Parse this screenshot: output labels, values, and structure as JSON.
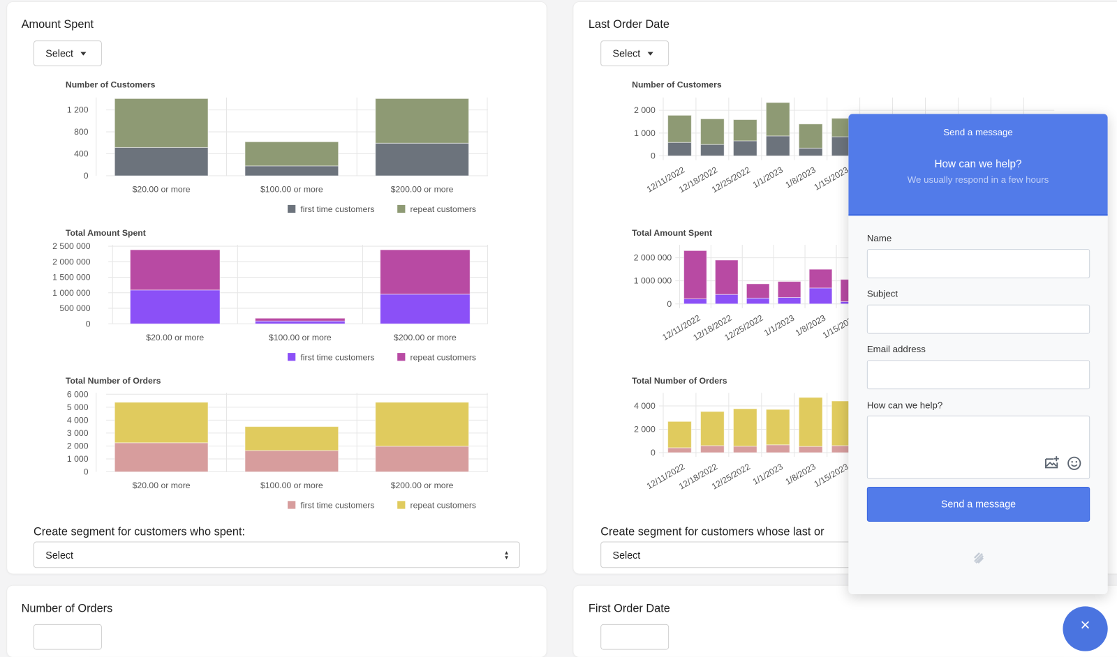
{
  "colors": {
    "accent": "#527be9",
    "first_gray": "#6c737c",
    "repeat_olive": "#8e9a74",
    "first_purple": "#8b50f7",
    "repeat_magenta": "#b84aa3",
    "first_pink": "#d79d9d",
    "repeat_yellow": "#e0cb5e"
  },
  "cards": {
    "amount_spent": {
      "title": "Amount Spent",
      "select_label": "Select",
      "segment_label": "Create segment for customers who spent:",
      "segment_value": "Select"
    },
    "last_order_date": {
      "title": "Last Order Date",
      "select_label": "Select",
      "segment_label": "Create segment for customers whose last or",
      "segment_value": "Select"
    },
    "number_of_orders": {
      "title": "Number of Orders"
    },
    "first_order_date": {
      "title": "First Order Date"
    }
  },
  "chart_data": [
    {
      "id": "amount_customers",
      "type": "bar",
      "stacked": true,
      "title": "Number of Customers",
      "categories": [
        "$20.00 or more",
        "$100.00 or more",
        "$200.00 or more"
      ],
      "ylim": [
        0,
        1400
      ],
      "yticks": [
        0,
        400,
        800,
        1200
      ],
      "ytick_labels": [
        "0",
        "400",
        "800",
        "1 200"
      ],
      "legend": "bottom-right",
      "series": [
        {
          "name": "first time customers",
          "color": "#6c737c",
          "values": [
            516,
            180,
            594
          ]
        },
        {
          "name": "repeat customers",
          "color": "#8e9a74",
          "values": [
            890,
            439,
            812
          ]
        }
      ]
    },
    {
      "id": "amount_total",
      "type": "bar",
      "stacked": true,
      "title": "Total Amount Spent",
      "categories": [
        "$20.00 or more",
        "$100.00 or more",
        "$200.00 or more"
      ],
      "ylim": [
        0,
        2500000
      ],
      "yticks": [
        0,
        500000,
        1000000,
        1500000,
        2000000,
        2500000
      ],
      "ytick_labels": [
        "0",
        "500 000",
        "1 000 000",
        "1 500 000",
        "2 000 000",
        "2 500 000"
      ],
      "legend": "bottom-right",
      "series": [
        {
          "name": "first time customers",
          "color": "#8b50f7",
          "values": [
            1090000,
            90000,
            955000
          ]
        },
        {
          "name": "repeat customers",
          "color": "#b84aa3",
          "values": [
            1296000,
            90000,
            1431000
          ]
        }
      ]
    },
    {
      "id": "amount_orders",
      "type": "bar",
      "stacked": true,
      "title": "Total Number of Orders",
      "categories": [
        "$20.00 or more",
        "$100.00 or more",
        "$200.00 or more"
      ],
      "ylim": [
        0,
        6000
      ],
      "yticks": [
        0,
        1000,
        2000,
        3000,
        4000,
        5000,
        6000
      ],
      "ytick_labels": [
        "0",
        "1 000",
        "2 000",
        "3 000",
        "4 000",
        "5 000",
        "6 000"
      ],
      "legend": "bottom-right",
      "series": [
        {
          "name": "first time customers",
          "color": "#d79d9d",
          "values": [
            2250,
            1650,
            1980
          ]
        },
        {
          "name": "repeat customers",
          "color": "#e0cb5e",
          "values": [
            3130,
            1850,
            3400
          ]
        }
      ]
    },
    {
      "id": "date_customers",
      "type": "bar",
      "stacked": true,
      "title": "Number of Customers",
      "categories": [
        "12/11/2022",
        "12/18/2022",
        "12/25/2022",
        "1/1/2023",
        "1/8/2023",
        "1/15/2023"
      ],
      "ylim": [
        0,
        2500
      ],
      "yticks": [
        0,
        1000,
        2000
      ],
      "ytick_labels": [
        "0",
        "1 000",
        "2 000"
      ],
      "series": [
        {
          "name": "first time customers",
          "color": "#6c737c",
          "values": [
            590,
            500,
            660,
            875,
            340,
            840
          ]
        },
        {
          "name": "repeat customers",
          "color": "#8e9a74",
          "values": [
            1190,
            1125,
            930,
            1465,
            1060,
            810
          ]
        }
      ]
    },
    {
      "id": "date_total",
      "type": "bar",
      "stacked": true,
      "title": "Total Amount Spent",
      "categories": [
        "12/11/2022",
        "12/18/2022",
        "12/25/2022",
        "1/1/2023",
        "1/8/2023",
        "1/15/2023"
      ],
      "ylim": [
        0,
        2500000
      ],
      "yticks": [
        0,
        1000000,
        2000000
      ],
      "ytick_labels": [
        "0",
        "1 000 000",
        "2 000 000"
      ],
      "series": [
        {
          "name": "first time customers",
          "color": "#8b50f7",
          "values": [
            220000,
            410000,
            250000,
            280000,
            690000,
            100000
          ]
        },
        {
          "name": "repeat customers",
          "color": "#b84aa3",
          "values": [
            2090000,
            1490000,
            620000,
            690000,
            810000,
            960000
          ]
        }
      ]
    },
    {
      "id": "date_orders",
      "type": "bar",
      "stacked": true,
      "title": "Total Number of Orders",
      "categories": [
        "12/11/2022",
        "12/18/2022",
        "12/25/2022",
        "1/1/2023",
        "1/8/2023",
        "1/15/2023"
      ],
      "ylim": [
        0,
        5000
      ],
      "yticks": [
        0,
        2000,
        4000
      ],
      "ytick_labels": [
        "0",
        "2 000",
        "4 000"
      ],
      "series": [
        {
          "name": "first time customers",
          "color": "#d79d9d",
          "values": [
            420,
            600,
            550,
            670,
            530,
            600
          ]
        },
        {
          "name": "repeat customers",
          "color": "#e0cb5e",
          "values": [
            2250,
            2920,
            3210,
            3030,
            4200,
            3820
          ]
        }
      ]
    }
  ],
  "chat": {
    "header_title": "Send a message",
    "heading": "How can we help?",
    "subheading": "We usually respond in a few hours",
    "fields": {
      "name": "Name",
      "subject": "Subject",
      "email": "Email address",
      "message": "How can we help?"
    },
    "submit_label": "Send a message",
    "image_icon": "image-add-icon",
    "emoji_icon": "emoji-icon",
    "logo_icon": "helpscout-logo-icon",
    "close_icon": "close-icon"
  }
}
